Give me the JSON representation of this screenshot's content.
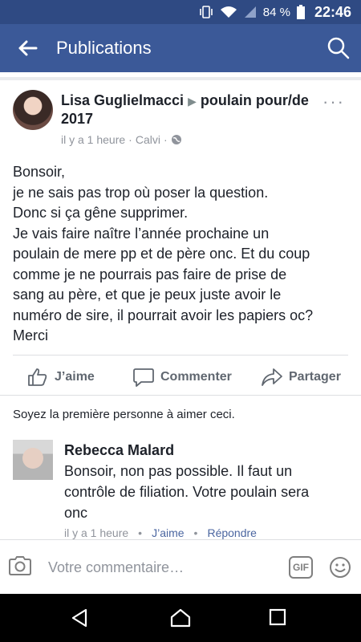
{
  "status_bar": {
    "battery": "84 %",
    "time": "22:46"
  },
  "app_bar": {
    "title": "Publications"
  },
  "post": {
    "author": "Lisa Guglielmacci",
    "group": "poulain pour/de 2017",
    "time": "il y a 1 heure",
    "location": "Calvi",
    "lines": [
      "Bonsoir,",
      "je ne sais pas trop où poser la question.",
      "Donc si ça gêne supprimer.",
      "Je vais faire naître l’année prochaine un",
      "poulain de mere pp et de père onc. Et du coup",
      "comme je ne pourrais pas faire de prise de",
      "sang au père, et que je peux juste avoir le",
      "numéro de sire, il pourrait avoir les papiers oc?",
      "Merci"
    ]
  },
  "actions": {
    "like": "J’aime",
    "comment": "Commenter",
    "share": "Partager"
  },
  "likes_text": "Soyez la première personne à aimer ceci.",
  "comment": {
    "author": "Rebecca Malard",
    "lines": [
      "Bonsoir, non pas possible. Il faut un",
      "contrôle de filiation. Votre poulain sera",
      "onc"
    ],
    "time": "il y a 1 heure",
    "like": "J’aime",
    "reply": "Répondre"
  },
  "composer": {
    "placeholder": "Votre commentaire…",
    "gif": "GIF"
  },
  "colors": {
    "header": "#3b5998",
    "status": "#2f4a83",
    "link": "#4b66a0"
  }
}
